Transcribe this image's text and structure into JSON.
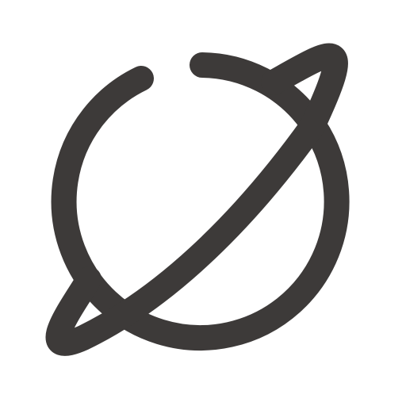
{
  "icon": {
    "name": "planet-icon",
    "stroke_color": "#3d3a39",
    "background_color": "#ffffff"
  }
}
